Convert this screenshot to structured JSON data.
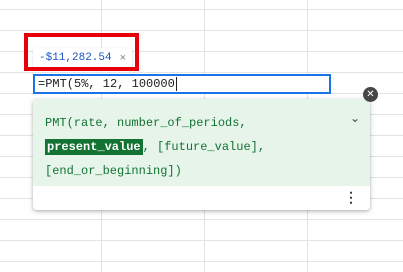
{
  "result_chip": {
    "value": "-$11,282.54",
    "close_icon": "close-icon"
  },
  "formula_cell": {
    "value": "=PMT(5%, 12, 100000"
  },
  "function_help": {
    "lines": [
      {
        "before": "PMT(rate, number_of_periods,",
        "highlight": "",
        "after": ""
      },
      {
        "before": "",
        "highlight": "present_value",
        "after": ", [future_value],"
      },
      {
        "before": "[end_or_beginning])",
        "highlight": "",
        "after": ""
      }
    ],
    "collapse_icon": "chevron-down-icon",
    "more_icon": "more-vert-icon",
    "dismiss_icon": "close-circle-icon"
  },
  "colors": {
    "accent": "#1a73e8",
    "highlight_border": "#e8000b",
    "syntax_bg": "#e6f4ea",
    "syntax_text": "#137333"
  }
}
